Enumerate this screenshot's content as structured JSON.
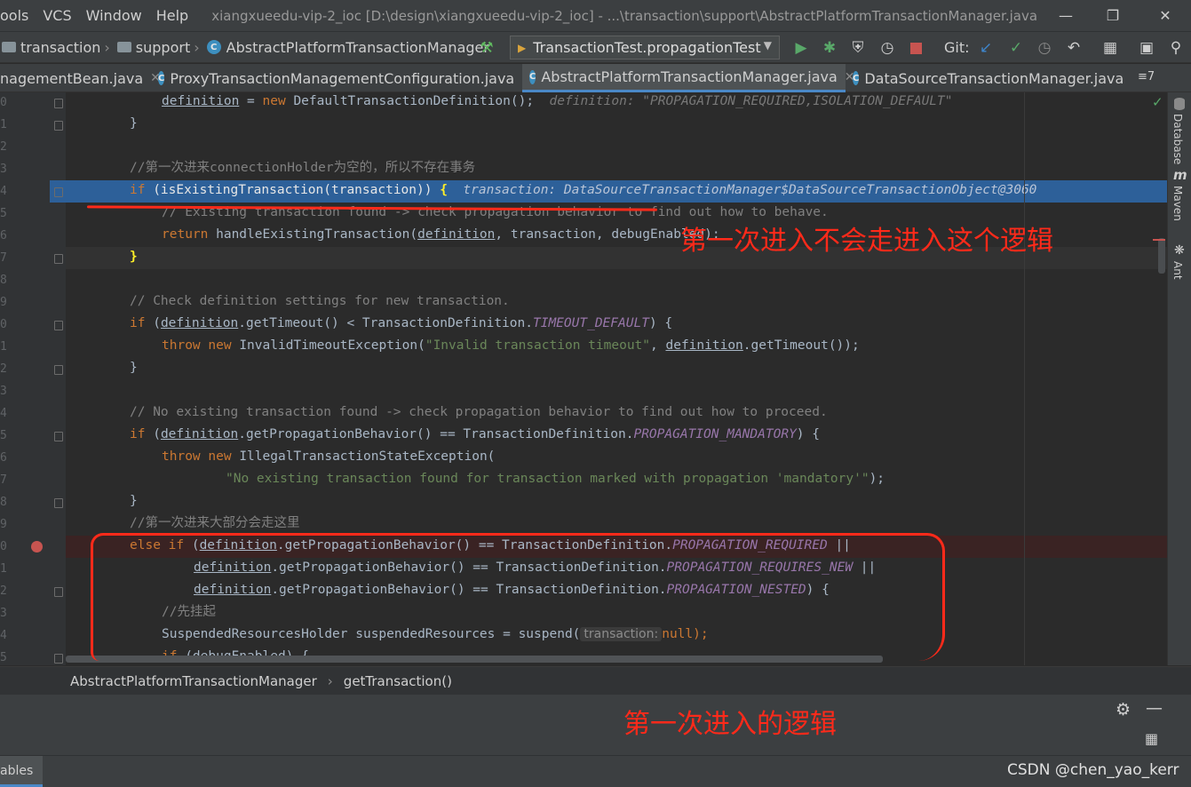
{
  "menu": {
    "items": [
      "ools",
      "VCS",
      "Window",
      "Help"
    ],
    "title": "xiangxueedu-vip-2_ioc [D:\\design\\xiangxueedu-vip-2_ioc] - ...\\transaction\\support\\AbstractPlatformTransactionManager.java"
  },
  "nav": {
    "crumbs": [
      "transaction",
      "support",
      "AbstractPlatformTransactionManager"
    ],
    "run_config": "TransactionTest.propagationTest",
    "git_label": "Git:"
  },
  "tabs": [
    {
      "label": "nagementBean.java",
      "active": false
    },
    {
      "label": "ProxyTransactionManagementConfiguration.java",
      "active": false
    },
    {
      "label": "AbstractPlatformTransactionManager.java",
      "active": true
    },
    {
      "label": "DataSourceTransactionManager.java",
      "active": false
    }
  ],
  "tab_overflow": "≡7",
  "gutter_digits": [
    "0",
    "1",
    "2",
    "3",
    "4",
    "5",
    "6",
    "7",
    "8",
    "9",
    "0",
    "1",
    "2",
    "3",
    "4",
    "5",
    "6",
    "7",
    "8",
    "9",
    "0",
    "1",
    "2",
    "3",
    "4",
    "5"
  ],
  "code": {
    "l0_a": "definition",
    "l0_b": " = ",
    "l0_c": "new",
    "l0_d": " DefaultTransactionDefinition();",
    "l0_hint": "definition: \"PROPAGATION_REQUIRED,ISOLATION_DEFAULT\"",
    "l1": "}",
    "l3": "//第一次进来connectionHolder为空的，所以不存在事务",
    "l4_a": "if",
    "l4_b": " (isExistingTransaction(transaction)) ",
    "l4_c": "{",
    "l4_hint": "transaction: DataSourceTransactionManager$DataSourceTransactionObject@3060",
    "l5": "// Existing transaction found -> check propagation behavior to find out how to behave.",
    "l6_a": "return",
    "l6_b": " handleExistingTransaction(",
    "l6_c": "definition",
    "l6_d": ", transaction, debugEnabled);",
    "l7": "}",
    "l9": "// Check definition settings for new transaction.",
    "l10_a": "if",
    "l10_b": " (",
    "l10_c": "definition",
    "l10_d": ".getTimeout() < TransactionDefinition.",
    "l10_e": "TIMEOUT_DEFAULT",
    "l10_f": ") {",
    "l11_a": "throw",
    "l11_b": " ",
    "l11_c": "new",
    "l11_d": " InvalidTimeoutException(",
    "l11_e": "\"Invalid transaction timeout\"",
    "l11_f": ", ",
    "l11_g": "definition",
    "l11_h": ".getTimeout());",
    "l12": "}",
    "l14": "// No existing transaction found -> check propagation behavior to find out how to proceed.",
    "l15_a": "if",
    "l15_b": " (",
    "l15_c": "definition",
    "l15_d": ".getPropagationBehavior() == TransactionDefinition.",
    "l15_e": "PROPAGATION_MANDATORY",
    "l15_f": ") {",
    "l16_a": "throw",
    "l16_b": " ",
    "l16_c": "new",
    "l16_d": " IllegalTransactionStateException(",
    "l17": "\"No existing transaction found for transaction marked with propagation 'mandatory'\"",
    "l17_b": ");",
    "l18": "}",
    "l19": "//第一次进来大部分会走这里",
    "l20_a": "else if",
    "l20_b": " (",
    "l20_c": "definition",
    "l20_d": ".getPropagationBehavior() == TransactionDefinition.",
    "l20_e": "PROPAGATION_REQUIRED",
    "l20_f": " ||",
    "l21_c": "definition",
    "l21_d": ".getPropagationBehavior() == TransactionDefinition.",
    "l21_e": "PROPAGATION_REQUIRES_NEW",
    "l21_f": " ||",
    "l22_c": "definition",
    "l22_d": ".getPropagationBehavior() == TransactionDefinition.",
    "l22_e": "PROPAGATION_NESTED",
    "l22_f": ") {",
    "l23": "//先挂起",
    "l24_a": "SuspendedResourcesHolder suspendedResources = suspend(",
    "l24_pill": "transaction:",
    "l24_b": "null);",
    "l25_a": "if",
    "l25_b": " (debugEnabled) {"
  },
  "right_tools": [
    "Database",
    "Maven",
    "Ant"
  ],
  "breadcrumb": [
    "AbstractPlatformTransactionManager",
    "getTransaction()"
  ],
  "status": {
    "left": "ables",
    "watermark": "CSDN @chen_yao_kerr"
  },
  "annotations": {
    "first_not_enter": "第一次进入不会走进入这个逻辑",
    "first_enter_logic": "第一次进入的逻辑"
  },
  "colors": {
    "highlight_line": "#2d6099",
    "breakpoint_line": "#3a2323",
    "annotation_red": "#ff2a1a"
  }
}
